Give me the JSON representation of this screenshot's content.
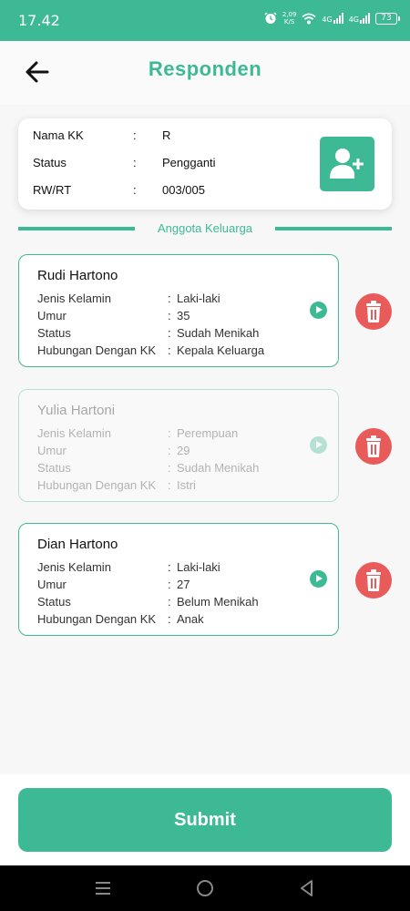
{
  "status_bar": {
    "time": "17.42",
    "speed_value": "2,09",
    "speed_unit": "K/S",
    "network_1": "4G",
    "network_2": "4G",
    "battery": "73"
  },
  "header": {
    "title": "Responden"
  },
  "info": {
    "separator": ":",
    "rows": [
      {
        "label": "Nama KK",
        "value": "R"
      },
      {
        "label": "Status",
        "value": "Pengganti"
      },
      {
        "label": "RW/RT",
        "value": "003/005"
      }
    ],
    "add_icon": "add-user-icon"
  },
  "section_title": "Anggota Keluarga",
  "members": [
    {
      "name": "Rudi Hartono",
      "fields": [
        {
          "label": "Jenis Kelamin",
          "value": "Laki-laki"
        },
        {
          "label": "Umur",
          "value": "35"
        },
        {
          "label": "Status",
          "value": "Sudah Menikah"
        },
        {
          "label": "Hubungan Dengan KK",
          "value": "Kepala Keluarga"
        }
      ]
    },
    {
      "name": "Yulia Hartoni",
      "disabled": true,
      "fields": [
        {
          "label": "Jenis Kelamin",
          "value": "Perempuan"
        },
        {
          "label": "Umur",
          "value": "29"
        },
        {
          "label": "Status",
          "value": "Sudah Menikah"
        },
        {
          "label": "Hubungan Dengan KK",
          "value": "Istri"
        }
      ]
    },
    {
      "name": "Dian Hartono",
      "fields": [
        {
          "label": "Jenis Kelamin",
          "value": "Laki-laki"
        },
        {
          "label": "Umur",
          "value": "27"
        },
        {
          "label": "Status",
          "value": "Belum Menikah"
        },
        {
          "label": "Hubungan Dengan KK",
          "value": "Anak"
        }
      ]
    }
  ],
  "field_separator": ":",
  "submit_label": "Submit",
  "colors": {
    "primary": "#3dba95",
    "danger": "#e95b5b"
  }
}
